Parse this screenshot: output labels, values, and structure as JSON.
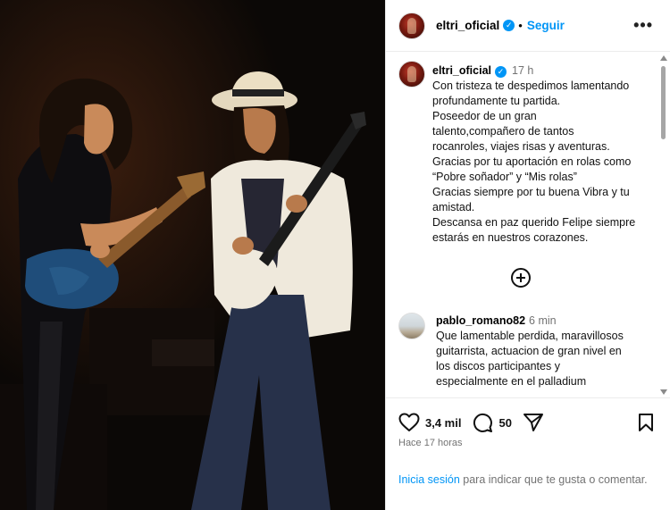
{
  "post": {
    "username": "eltri_oficial",
    "verified": true,
    "follow_label": "Seguir",
    "more_label": "•••",
    "caption_time": "17 h",
    "caption_lines": [
      "Con tristeza te despedimos lamentando",
      "profundamente tu partida.",
      "Poseedor de un gran",
      "talento,compañero de tantos",
      "rocanroles, viajes risas y aventuras.",
      "Gracias por tu aportación en rolas como",
      "“Pobre soñador” y “Mis rolas”",
      "Gracias siempre por tu buena Vibra y tu",
      "amistad.",
      "Descansa en paz querido Felipe siempre",
      "estarás en nuestros corazones."
    ]
  },
  "comment": {
    "username": "pablo_romano82",
    "time": "6 min",
    "lines": [
      "Que lamentable perdida, maravillosos",
      "guitarrista, actuacion de gran nivel en",
      "los discos participantes y",
      "especialmente en el palladium"
    ]
  },
  "actions": {
    "likes": "3,4 mil",
    "comments": "50",
    "posted_ago": "Hace 17 horas",
    "login_link": "Inicia sesión",
    "login_rest": " para indicar que te gusta o comentar."
  },
  "icons": [
    "heart-icon",
    "comment-icon",
    "share-icon",
    "bookmark-icon",
    "add-icon",
    "verified-badge-icon",
    "more-options-icon"
  ],
  "colors": {
    "accent": "#0095f6",
    "muted": "#737373"
  }
}
